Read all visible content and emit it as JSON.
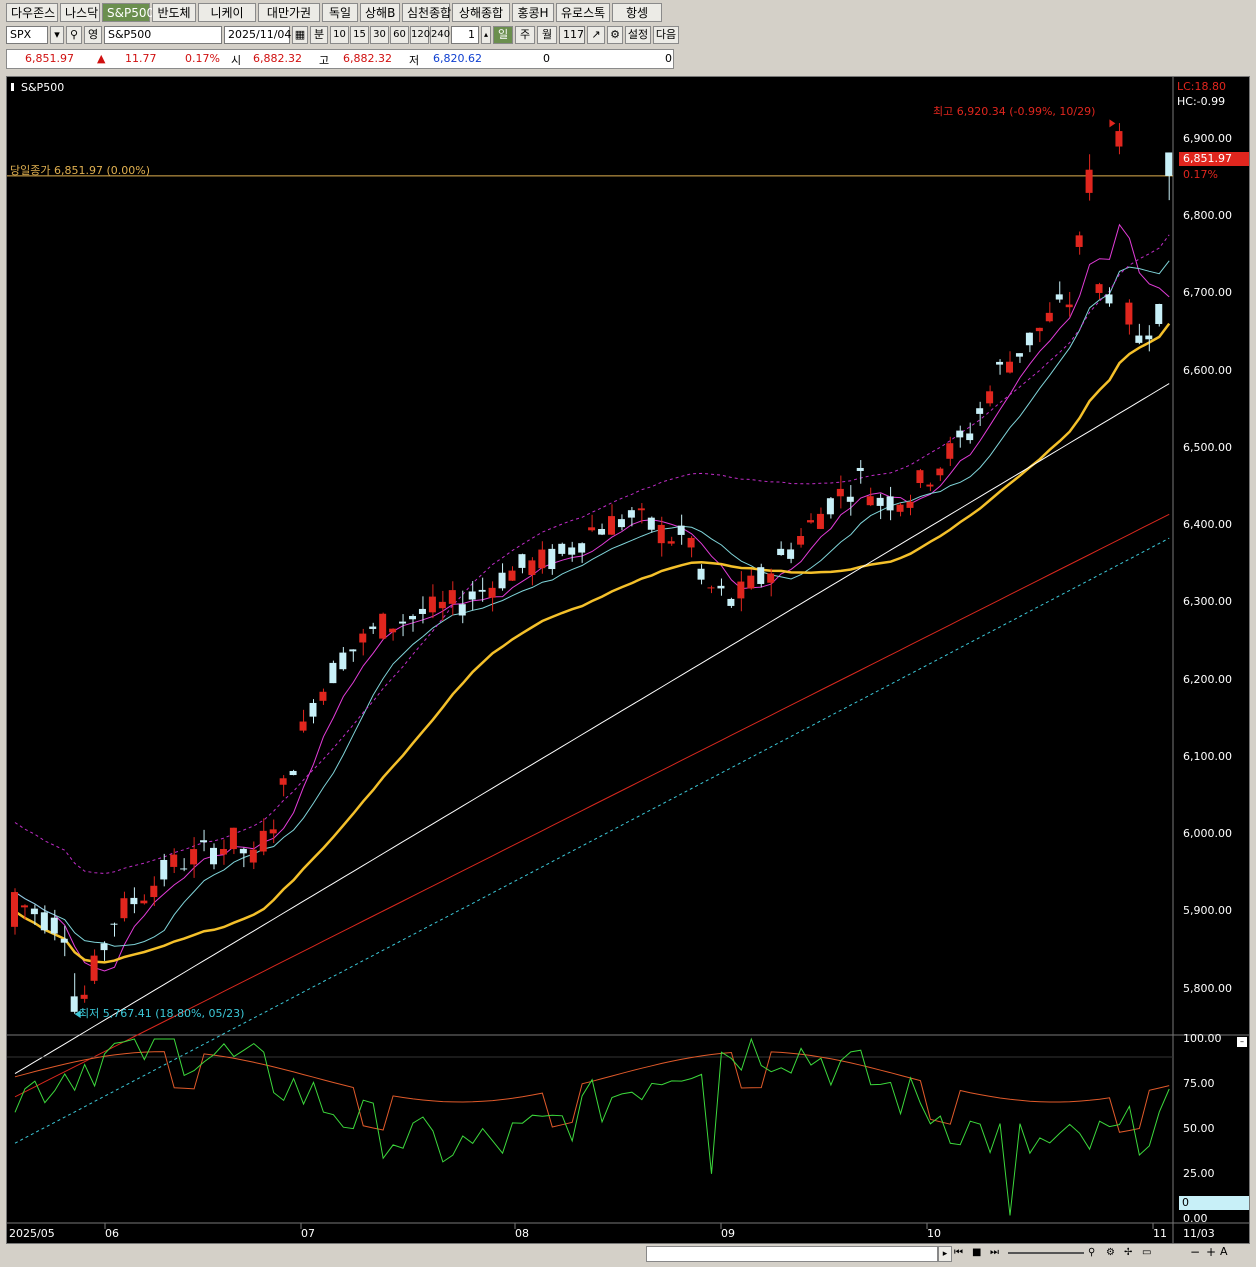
{
  "tabs": [
    {
      "label": "다우존스",
      "active": false
    },
    {
      "label": "나스닥",
      "active": false
    },
    {
      "label": "S&P500",
      "active": true
    },
    {
      "label": "반도체",
      "active": false
    },
    {
      "label": "니케이",
      "active": false
    },
    {
      "label": "대만가권",
      "active": false
    },
    {
      "label": "독일",
      "active": false
    },
    {
      "label": "상해B",
      "active": false
    },
    {
      "label": "심천종합",
      "active": false
    },
    {
      "label": "상해종합",
      "active": false
    },
    {
      "label": "홍콩H",
      "active": false
    },
    {
      "label": "유로스톡",
      "active": false
    },
    {
      "label": "항셍",
      "active": false
    }
  ],
  "toolbar": {
    "symbol": "SPX",
    "name_mode": "영",
    "name": "S&P500",
    "date": "2025/11/04",
    "minute_label": "분",
    "intervals": [
      "10",
      "15",
      "30",
      "60",
      "120",
      "240"
    ],
    "multiplier": "1",
    "day_label": "일",
    "week_label": "주",
    "month_label": "월",
    "count": "117",
    "settings_label": "설정",
    "next_label": "다음"
  },
  "quote": {
    "price": "6,851.97",
    "change_arrow": "▲",
    "change": "11.77",
    "change_pct": "0.17%",
    "open_label": "시",
    "open": "6,882.32",
    "high_label": "고",
    "high": "6,882.32",
    "low_label": "저",
    "low": "6,820.62",
    "vol1": "0",
    "vol2": "0"
  },
  "chart": {
    "title": "S&P500",
    "close_line_label": "당일종가 6,851.97 (0.00%)",
    "max_label": "최고 6,920.34 (-0.99%, 10/29)",
    "min_label": "최저 5,767.41 (18.80%, 05/23)",
    "lc_label": "LC:18.80",
    "hc_label": "HC:-0.99",
    "price_tag": "6,851.97",
    "price_tag_pct": "0.17%",
    "price_ticks": [
      "6,900.00",
      "6,800.00",
      "6,700.00",
      "6,600.00",
      "6,500.00",
      "6,400.00",
      "6,300.00",
      "6,200.00",
      "6,100.00",
      "6,000.00",
      "5,900.00",
      "5,800.00"
    ],
    "osc_ticks": [
      "100.00",
      "75.00",
      "50.00",
      "25.00",
      "0.00"
    ],
    "osc_value": "0",
    "x_labels": [
      "2025/05",
      "06",
      "07",
      "08",
      "09",
      "10",
      "11",
      "11/03"
    ],
    "colors": {
      "up": "#e0261e",
      "down": "#c8f0f8",
      "ma5": "#e23cd8",
      "ma10": "#7fd3d8",
      "ma20": "#f4c02a",
      "ma60": "#ffffff",
      "ma120": "#d8281e",
      "ma200": "#3cc8d8",
      "bb": "#c02cc8",
      "close_line": "#e0b050"
    }
  },
  "chart_data": {
    "type": "candlestick",
    "ylim": [
      5740,
      6980
    ],
    "osc_ylim": [
      0,
      100
    ],
    "x_months": [
      "2025/05",
      "06",
      "07",
      "08",
      "09",
      "10",
      "11"
    ],
    "ohlc": []
  }
}
